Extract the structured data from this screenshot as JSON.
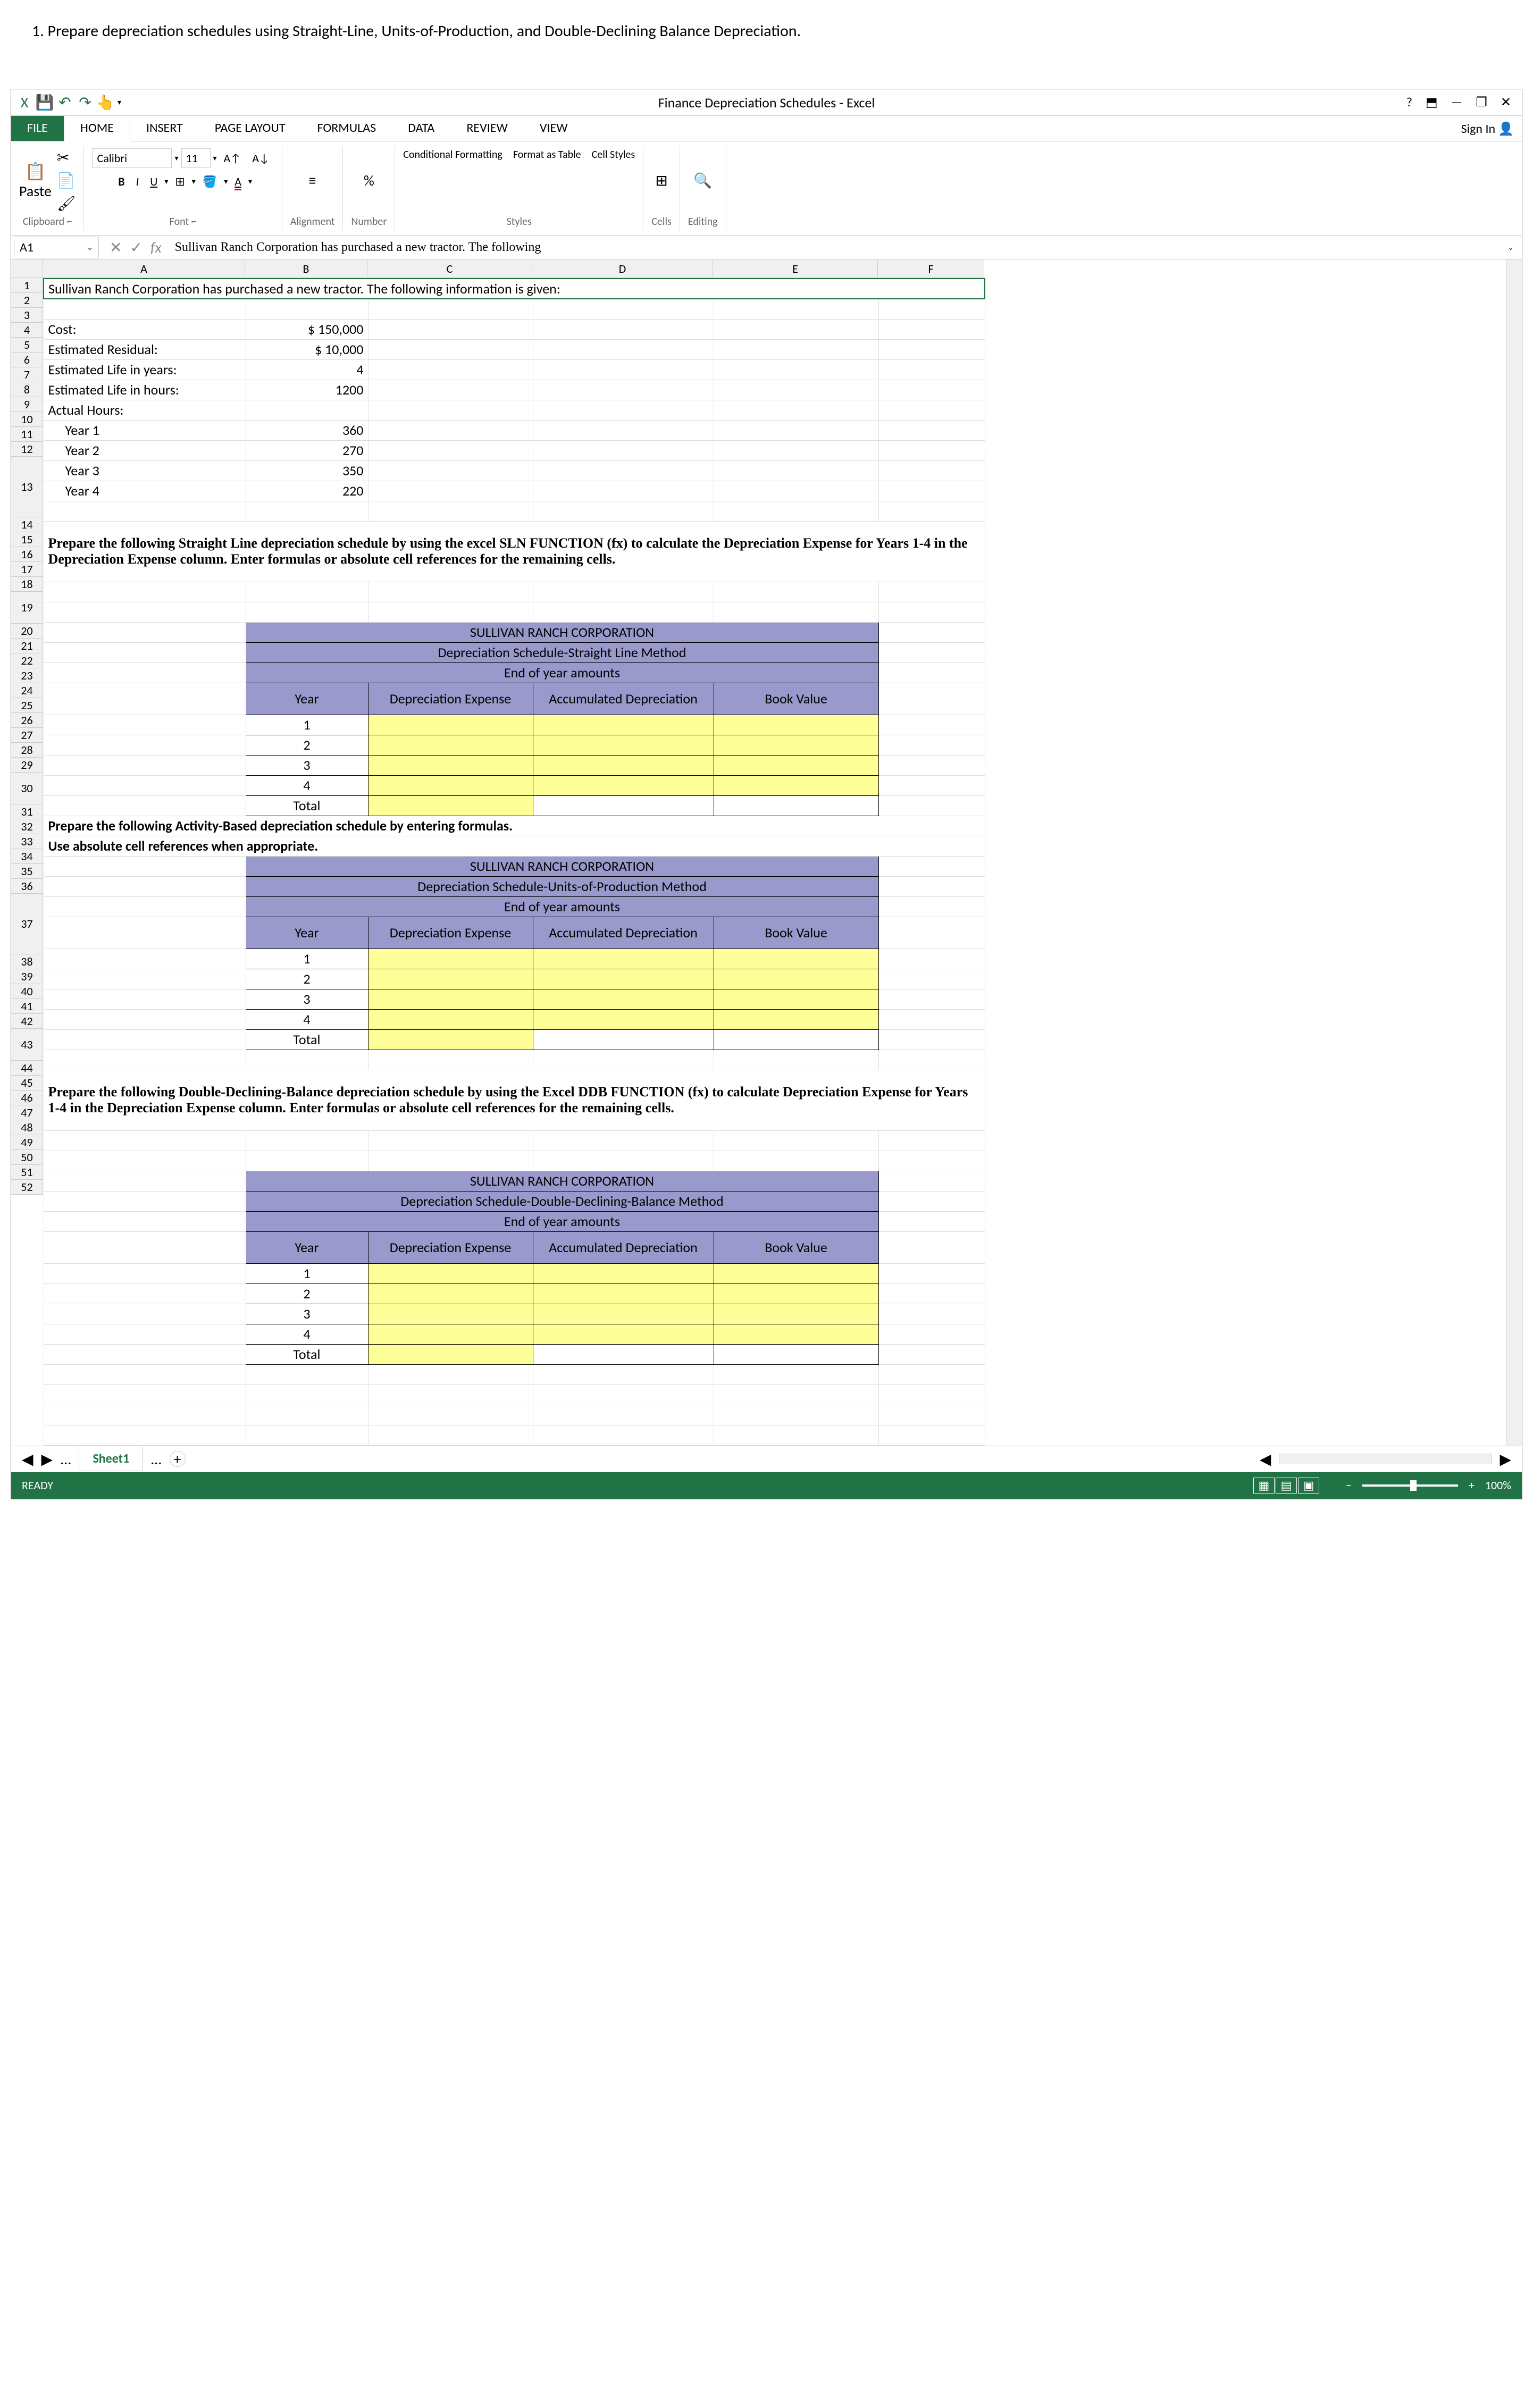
{
  "page_instruction": "1. Prepare depreciation schedules using Straight-Line, Units-of-Production, and Double-Declining Balance Depreciation.",
  "window": {
    "title": "Finance Depreciation Schedules - Excel",
    "sign_in": "Sign In"
  },
  "ribbon_tabs": {
    "file": "FILE",
    "home": "HOME",
    "insert": "INSERT",
    "page_layout": "PAGE LAYOUT",
    "formulas": "FORMULAS",
    "data": "DATA",
    "review": "REVIEW",
    "view": "VIEW"
  },
  "ribbon": {
    "paste": "Paste",
    "clipboard": "Clipboard",
    "font_name": "Calibri",
    "font_size": "11",
    "font": "Font",
    "alignment": "Alignment",
    "number": "Number",
    "cond_fmt": "Conditional Formatting",
    "fmt_table": "Format as Table",
    "cell_styles": "Cell Styles",
    "styles": "Styles",
    "cells": "Cells",
    "editing": "Editing"
  },
  "namebox": "A1",
  "formula_bar": "Sullivan Ranch Corporation has purchased a new tractor. The following",
  "columns": [
    "A",
    "B",
    "C",
    "D",
    "E",
    "F"
  ],
  "rows": {
    "r1": "Sullivan Ranch Corporation has purchased a new tractor. The following information is given:",
    "r3a": "Cost:",
    "r3b": "$    150,000",
    "r4a": "Estimated Residual:",
    "r4b": "$      10,000",
    "r5a": "Estimated Life in years:",
    "r5b": "4",
    "r6a": "Estimated Life in hours:",
    "r6b": "1200",
    "r7a": "Actual Hours:",
    "r8a": "    Year 1",
    "r8b": "360",
    "r9a": "    Year 2",
    "r9b": "270",
    "r10a": "    Year 3",
    "r10b": "350",
    "r11a": "    Year 4",
    "r11b": "220",
    "r13": "Prepare the following Straight Line depreciation schedule by using the excel SLN FUNCTION (fx) to calculate the Depreciation Expense for Years 1-4 in the Depreciation Expense column. Enter formulas or absolute cell references for the remaining cells.",
    "corp": "SULLIVAN RANCH CORPORATION",
    "sl_method": "Depreciation Schedule-Straight Line Method",
    "eoy": "End of year amounts",
    "year": "Year",
    "dep_exp": "Depreciation Expense",
    "acc_dep": "Accumulated Depreciation",
    "book_val": "Book Value",
    "y1": "1",
    "y2": "2",
    "y3": "3",
    "y4": "4",
    "total": "Total",
    "r25": "Prepare the following Activity-Based depreciation schedule by entering formulas.",
    "r26": "Use absolute cell references when appropriate.",
    "uop_method": "Depreciation Schedule-Units-of-Production Method",
    "r37": "Prepare the following Double-Declining-Balance depreciation schedule by using the Excel DDB FUNCTION (fx) to calculate Depreciation Expense for Years 1-4 in the Depreciation Expense column. Enter formulas or absolute cell references for the remaining cells.",
    "ddb_method": "Depreciation Schedule-Double-Declining-Balance Method"
  },
  "sheet_tab": "Sheet1",
  "status": {
    "ready": "READY",
    "zoom": "100%"
  }
}
